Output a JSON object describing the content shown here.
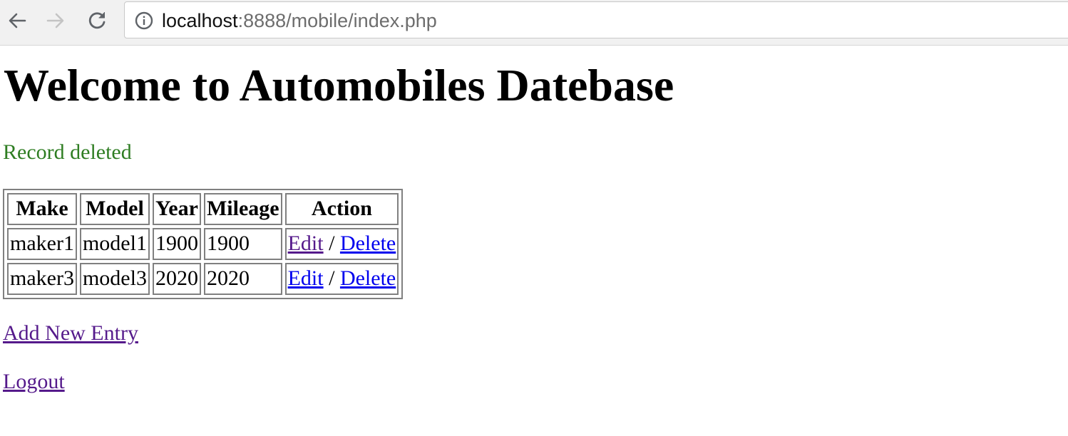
{
  "browser": {
    "url_host": "localhost",
    "url_rest": ":8888/mobile/index.php"
  },
  "page": {
    "title": "Welcome to Automobiles Datebase",
    "flash_message": "Record deleted",
    "table": {
      "headers": [
        "Make",
        "Model",
        "Year",
        "Mileage",
        "Action"
      ],
      "rows": [
        {
          "make": "maker1",
          "model": "model1",
          "year": "1900",
          "mileage": "1900",
          "edit": "Edit",
          "separator": "/",
          "delete": "Delete"
        },
        {
          "make": "maker3",
          "model": "model3",
          "year": "2020",
          "mileage": "2020",
          "edit": "Edit",
          "separator": "/",
          "delete": "Delete"
        }
      ]
    },
    "add_link": "Add New Entry",
    "logout_link": "Logout"
  },
  "colors": {
    "flash": "#2e7d22",
    "visited_link": "#551a8b",
    "unvisited_link": "#0000ee"
  },
  "icons": {
    "back": "arrow-left-icon",
    "forward": "arrow-right-icon",
    "reload": "reload-icon",
    "info": "info-icon"
  }
}
